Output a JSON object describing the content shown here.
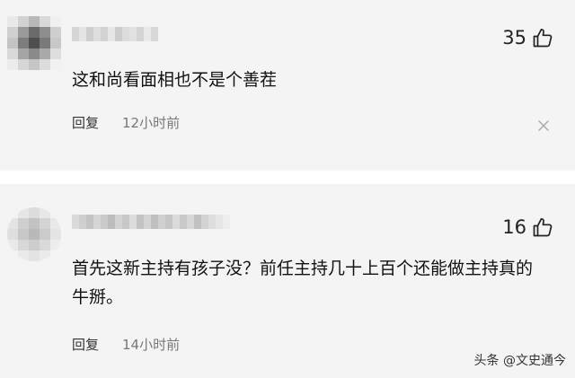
{
  "comments": [
    {
      "likes": "35",
      "text": "这和尚看面相也不是个善茬",
      "reply_label": "回复",
      "time": "12小时前"
    },
    {
      "likes": "16",
      "text": "首先这新主持有孩子没？前任主持几十上百个还能做主持真的牛掰。",
      "reply_label": "回复",
      "time": "14小时前"
    }
  ],
  "watermark": "头条 @文史通今",
  "colors": {
    "background": "#f4f4f4",
    "text": "#111111",
    "muted": "#777777"
  }
}
